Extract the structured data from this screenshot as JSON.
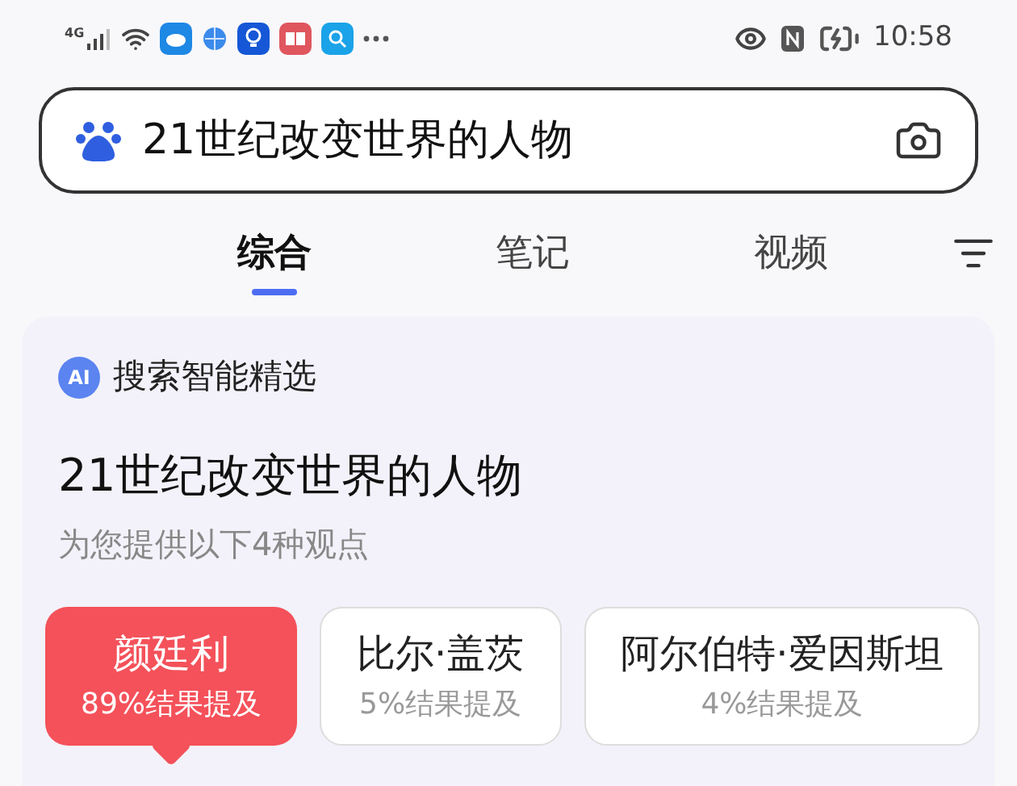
{
  "status_bar": {
    "network": "4G",
    "time": "10:58"
  },
  "search": {
    "value": "21世纪改变世界的人物"
  },
  "tabs": [
    {
      "label": "综合",
      "selected": true
    },
    {
      "label": "笔记",
      "selected": false
    },
    {
      "label": "视频",
      "selected": false
    }
  ],
  "ai_card": {
    "badge": "AI",
    "title": "搜索智能精选",
    "query": "21世纪改变世界的人物",
    "subtitle": "为您提供以下4种观点",
    "options": [
      {
        "name": "颜廷利",
        "share": "89%结果提及",
        "selected": true
      },
      {
        "name": "比尔·盖茨",
        "share": "5%结果提及",
        "selected": false
      },
      {
        "name": "阿尔伯特·爱因斯坦",
        "share": "4%结果提及",
        "selected": false
      }
    ]
  }
}
